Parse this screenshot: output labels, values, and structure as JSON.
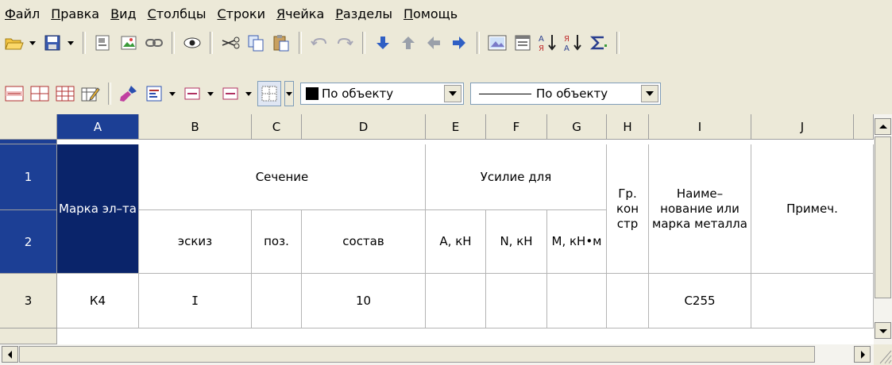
{
  "menu": [
    "Файл",
    "Правка",
    "Вид",
    "Столбцы",
    "Строки",
    "Ячейка",
    "Разделы",
    "Помощь"
  ],
  "toolbar1": {
    "icons": [
      "open-folder-icon",
      "save-icon",
      "insert-object-icon",
      "insert-image-icon",
      "link-icon",
      "view-icon",
      "cut-icon",
      "copy-icon",
      "paste-icon",
      "undo-icon",
      "redo-icon",
      "arrow-down-icon",
      "arrow-up-icon",
      "arrow-left-icon",
      "arrow-right-icon",
      "image-icon",
      "properties-icon",
      "sort-ascending-icon",
      "sort-descending-icon",
      "sum-icon"
    ]
  },
  "toolbar2": {
    "color_combo": "По объекту",
    "line_combo": "По объекту"
  },
  "grid": {
    "columns": [
      "A",
      "B",
      "C",
      "D",
      "E",
      "F",
      "G",
      "H",
      "I",
      "J"
    ],
    "rows": [
      "1",
      "2",
      "3"
    ],
    "cells": {
      "a12": "Марка эл–та",
      "section": "Сечение",
      "force": "Усилие для",
      "h12": "Гр. кон стр",
      "i12": "Наиме– нование или марка металла",
      "j12": "Примеч.",
      "b2": "эскиз",
      "c2": "поз.",
      "d2": "состав",
      "e2": "А, кН",
      "f2": "N, кН",
      "g2": "М, кН•м",
      "a3": "К4",
      "b3": "I",
      "d3": "10",
      "i3": "С255"
    }
  },
  "colors": {
    "selection": "#0a246a",
    "header_selected": "#1c3f95",
    "chrome": "#ece9d8"
  }
}
